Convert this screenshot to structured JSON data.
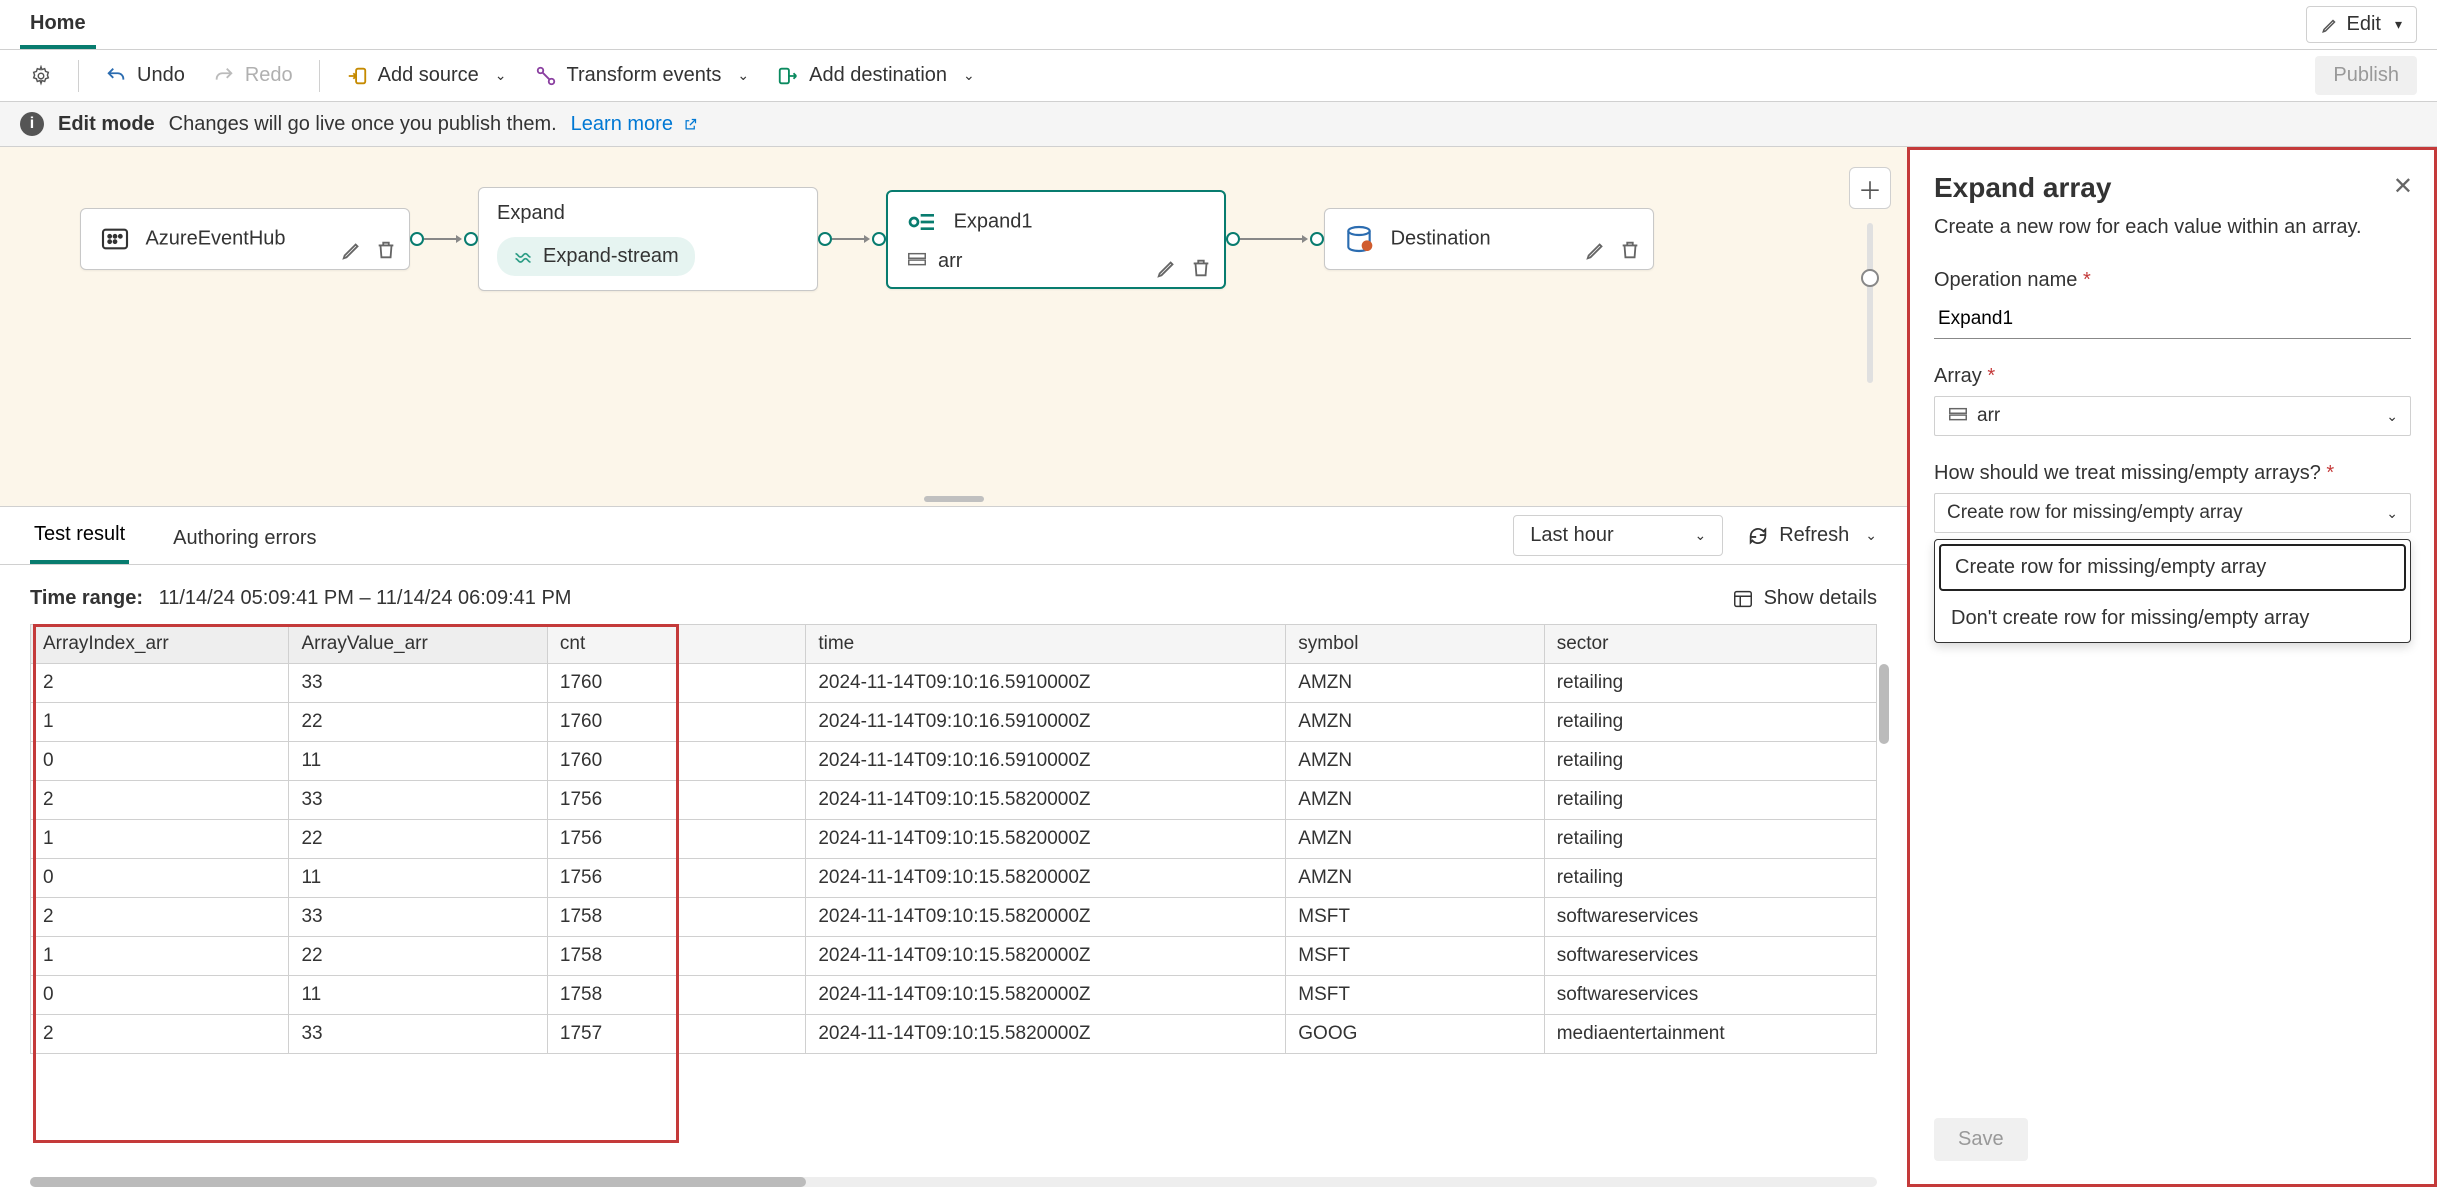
{
  "top": {
    "home_tab": "Home",
    "edit_btn": "Edit"
  },
  "cmd": {
    "undo": "Undo",
    "redo": "Redo",
    "add_source": "Add source",
    "transform": "Transform events",
    "add_dest": "Add destination",
    "publish": "Publish"
  },
  "info": {
    "mode": "Edit mode",
    "desc": "Changes will go live once you publish them.",
    "learn": "Learn more"
  },
  "nodes": {
    "source": "AzureEventHub",
    "expand_title": "Expand",
    "expand_pill": "Expand-stream",
    "expand1_title": "Expand1",
    "expand1_field": "arr",
    "dest": "Destination"
  },
  "tabs": {
    "test": "Test result",
    "errors": "Authoring errors",
    "last_hour": "Last hour",
    "refresh": "Refresh"
  },
  "time": {
    "label": "Time range:",
    "value": "11/14/24 05:09:41 PM  –  11/14/24 06:09:41 PM",
    "details": "Show details"
  },
  "table": {
    "headers": [
      "ArrayIndex_arr",
      "ArrayValue_arr",
      "cnt",
      "time",
      "symbol",
      "sector"
    ],
    "rows": [
      [
        "2",
        "33",
        "1760",
        "2024-11-14T09:10:16.5910000Z",
        "AMZN",
        "retailing"
      ],
      [
        "1",
        "22",
        "1760",
        "2024-11-14T09:10:16.5910000Z",
        "AMZN",
        "retailing"
      ],
      [
        "0",
        "11",
        "1760",
        "2024-11-14T09:10:16.5910000Z",
        "AMZN",
        "retailing"
      ],
      [
        "2",
        "33",
        "1756",
        "2024-11-14T09:10:15.5820000Z",
        "AMZN",
        "retailing"
      ],
      [
        "1",
        "22",
        "1756",
        "2024-11-14T09:10:15.5820000Z",
        "AMZN",
        "retailing"
      ],
      [
        "0",
        "11",
        "1756",
        "2024-11-14T09:10:15.5820000Z",
        "AMZN",
        "retailing"
      ],
      [
        "2",
        "33",
        "1758",
        "2024-11-14T09:10:15.5820000Z",
        "MSFT",
        "softwareservices"
      ],
      [
        "1",
        "22",
        "1758",
        "2024-11-14T09:10:15.5820000Z",
        "MSFT",
        "softwareservices"
      ],
      [
        "0",
        "11",
        "1758",
        "2024-11-14T09:10:15.5820000Z",
        "MSFT",
        "softwareservices"
      ],
      [
        "2",
        "33",
        "1757",
        "2024-11-14T09:10:15.5820000Z",
        "GOOG",
        "mediaentertainment"
      ]
    ]
  },
  "panel": {
    "title": "Expand array",
    "sub": "Create a new row for each value within an array.",
    "op_label": "Operation name",
    "op_value": "Expand1",
    "arr_label": "Array",
    "arr_value": "arr",
    "missing_label": "How should we treat missing/empty arrays?",
    "missing_value": "Create row for missing/empty array",
    "opt1": "Create row for missing/empty array",
    "opt2": "Don't create row for missing/empty array",
    "save": "Save"
  }
}
